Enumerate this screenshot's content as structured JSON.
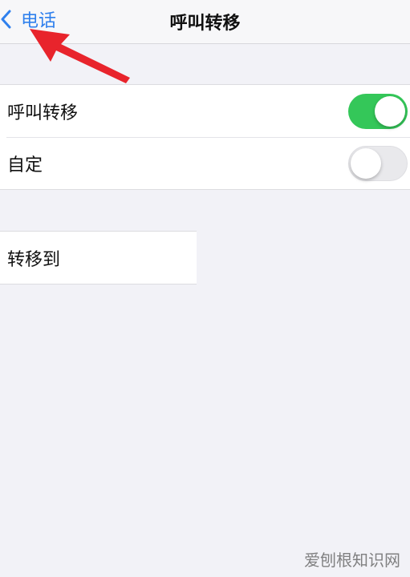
{
  "nav": {
    "back_label": "电话",
    "title": "呼叫转移",
    "accent_color": "#2f80ed"
  },
  "settings": {
    "items": [
      {
        "label": "呼叫转移",
        "toggle": "on"
      },
      {
        "label": "自定",
        "toggle": "off"
      }
    ],
    "forward_to": {
      "label": "转移到"
    }
  },
  "colors": {
    "switch_on": "#34c759",
    "switch_off": "#e9e9ec",
    "annotation_arrow": "#e8242c",
    "background": "#f2f2f7"
  },
  "icons": {
    "back": "chevron-left-icon",
    "annotation": "red-arrow-icon"
  },
  "watermark": {
    "text": "爱刨根知识网"
  }
}
